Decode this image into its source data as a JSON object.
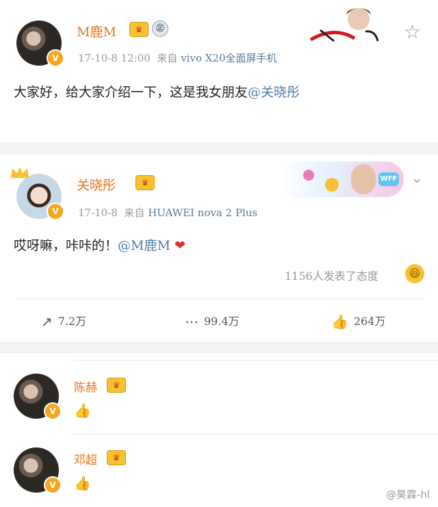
{
  "post1": {
    "name": "M鹿M",
    "vip": "♛",
    "medal": "㊣",
    "date": "17-10-8 12:00",
    "source_prefix": "来自",
    "device": "vivo X20全面屏手机",
    "text": "大家好，给大家介绍一下，这是我女朋友",
    "mention": "@关晓彤",
    "star_icon": "☆"
  },
  "post2": {
    "name": "关晓彤",
    "vip": "♛",
    "date": "17-10-8",
    "source_prefix": "来自",
    "device": "HUAWEI nova 2 Plus",
    "text": "哎呀嘛，咔咔的！",
    "mention": "@M鹿M",
    "heart": "❤",
    "reactions": "1156人发表了态度",
    "reaction_emoji": "😆",
    "banner_text": "WFF",
    "chevron": "⌄",
    "actions": {
      "repost": "7.2万",
      "comment": "99.4万",
      "like": "264万"
    }
  },
  "comments": [
    {
      "name": "陈赫",
      "vip": "♛",
      "emoji": "👍"
    },
    {
      "name": "邓超",
      "vip": "♛",
      "emoji": "👍"
    }
  ],
  "watermark": "@昊霖-hl",
  "colors": {
    "name": "#e8731b",
    "link": "#4c7ba8",
    "badge": "#f5a623"
  }
}
